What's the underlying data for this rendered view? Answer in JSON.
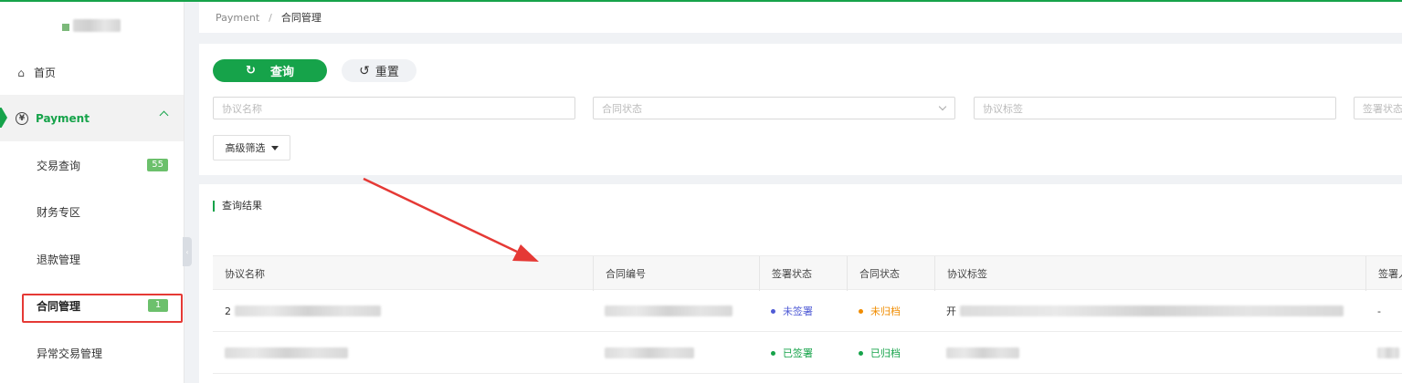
{
  "breadcrumb": {
    "parent": "Payment",
    "separator": "/",
    "current": "合同管理"
  },
  "sidebar": {
    "home": {
      "label": "首页",
      "icon": "home-icon"
    },
    "payment": {
      "label": "Payment",
      "icon": "yen-icon",
      "icon_glyph": "¥"
    },
    "items": [
      {
        "label": "交易查询",
        "badge": "55"
      },
      {
        "label": "财务专区"
      },
      {
        "label": "退款管理"
      },
      {
        "label": "合同管理",
        "badge": "1"
      },
      {
        "label": "异常交易管理"
      }
    ]
  },
  "query": {
    "search_label": "查询",
    "reset_label": "重置",
    "fields": {
      "agreement_name": {
        "placeholder": "协议名称"
      },
      "contract_status": {
        "placeholder": "合同状态"
      },
      "agreement_tag": {
        "placeholder": "协议标签"
      },
      "sign_status": {
        "placeholder": "签署状态"
      }
    },
    "advanced_label": "高级筛选"
  },
  "results": {
    "title": "查询结果",
    "columns": [
      "协议名称",
      "合同编号",
      "签署状态",
      "合同状态",
      "协议标签",
      "签署人"
    ],
    "rows": [
      {
        "name_prefix": "2",
        "sign_status": "未签署",
        "contract_status": "未归档",
        "tag_prefix": "开",
        "signer": "-"
      },
      {
        "name_prefix": "",
        "sign_status": "已签署",
        "contract_status": "已归档",
        "tag_prefix": "",
        "signer": ""
      }
    ]
  },
  "colors": {
    "brand": "#16a34a",
    "unsigned": "#4f5bd5",
    "unarchived": "#f08c00",
    "annotation": "#e53935"
  }
}
